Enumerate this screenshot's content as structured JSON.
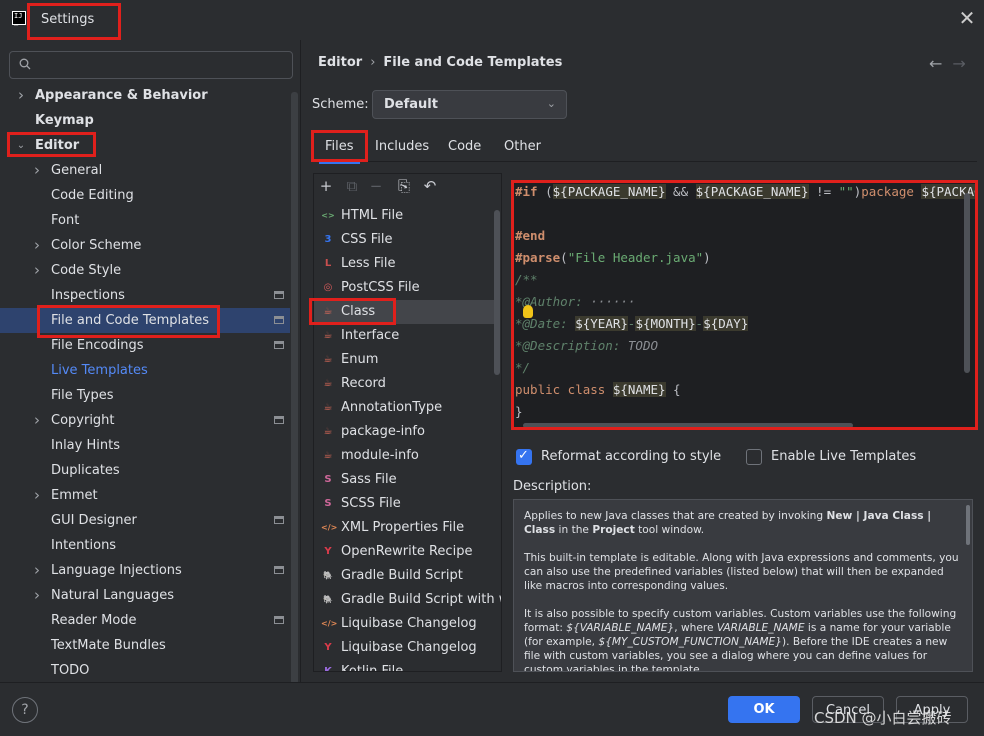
{
  "window": {
    "title": "Settings",
    "close_label": "✕"
  },
  "sidebar": {
    "search_placeholder": "",
    "items": [
      {
        "label": "Appearance & Behavior",
        "level": 0,
        "expand": "collapsed",
        "bold": true
      },
      {
        "label": "Keymap",
        "level": 0,
        "expand": "none",
        "bold": true
      },
      {
        "label": "Editor",
        "level": 0,
        "expand": "expanded",
        "bold": true
      },
      {
        "label": "General",
        "level": 1,
        "expand": "collapsed"
      },
      {
        "label": "Code Editing",
        "level": 1,
        "expand": "none"
      },
      {
        "label": "Font",
        "level": 1,
        "expand": "none"
      },
      {
        "label": "Color Scheme",
        "level": 1,
        "expand": "collapsed"
      },
      {
        "label": "Code Style",
        "level": 1,
        "expand": "collapsed"
      },
      {
        "label": "Inspections",
        "level": 1,
        "expand": "none",
        "project": true
      },
      {
        "label": "File and Code Templates",
        "level": 1,
        "expand": "none",
        "project": true,
        "selected": true
      },
      {
        "label": "File Encodings",
        "level": 1,
        "expand": "none",
        "project": true
      },
      {
        "label": "Live Templates",
        "level": 1,
        "expand": "none",
        "link": true
      },
      {
        "label": "File Types",
        "level": 1,
        "expand": "none"
      },
      {
        "label": "Copyright",
        "level": 1,
        "expand": "collapsed",
        "project": true
      },
      {
        "label": "Inlay Hints",
        "level": 1,
        "expand": "none"
      },
      {
        "label": "Duplicates",
        "level": 1,
        "expand": "none"
      },
      {
        "label": "Emmet",
        "level": 1,
        "expand": "collapsed"
      },
      {
        "label": "GUI Designer",
        "level": 1,
        "expand": "none",
        "project": true
      },
      {
        "label": "Intentions",
        "level": 1,
        "expand": "none"
      },
      {
        "label": "Language Injections",
        "level": 1,
        "expand": "collapsed",
        "project": true
      },
      {
        "label": "Natural Languages",
        "level": 1,
        "expand": "collapsed"
      },
      {
        "label": "Reader Mode",
        "level": 1,
        "expand": "none",
        "project": true
      },
      {
        "label": "TextMate Bundles",
        "level": 1,
        "expand": "none"
      },
      {
        "label": "TODO",
        "level": 1,
        "expand": "none"
      }
    ]
  },
  "breadcrumb": {
    "parent": "Editor",
    "separator": "›",
    "current": "File and Code Templates"
  },
  "nav": {
    "back": "←",
    "forward": "→"
  },
  "scheme": {
    "label": "Scheme:",
    "value": "Default",
    "arrow": "⌄"
  },
  "tabs": [
    {
      "label": "Files",
      "active": true
    },
    {
      "label": "Includes",
      "active": false
    },
    {
      "label": "Code",
      "active": false
    },
    {
      "label": "Other",
      "active": false
    }
  ],
  "toolbar": {
    "add": "+",
    "copy": "⧉",
    "remove": "−",
    "duplicate": "⎘",
    "reset": "↶"
  },
  "templates": [
    {
      "label": "HTML File",
      "icon": "html-file-icon",
      "glyph": "<>",
      "color": "#6aab73"
    },
    {
      "label": "CSS File",
      "icon": "css-file-icon",
      "glyph": "3",
      "color": "#3574f0"
    },
    {
      "label": "Less File",
      "icon": "less-file-icon",
      "glyph": "L",
      "color": "#c94f4f"
    },
    {
      "label": "PostCSS File",
      "icon": "postcss-file-icon",
      "glyph": "◎",
      "color": "#db5c5c"
    },
    {
      "label": "Class",
      "icon": "class-template-icon",
      "glyph": "☕",
      "color": "#e06c5a",
      "selected": true
    },
    {
      "label": "Interface",
      "icon": "interface-template-icon",
      "glyph": "☕",
      "color": "#e06c5a"
    },
    {
      "label": "Enum",
      "icon": "enum-template-icon",
      "glyph": "☕",
      "color": "#e06c5a"
    },
    {
      "label": "Record",
      "icon": "record-template-icon",
      "glyph": "☕",
      "color": "#e06c5a"
    },
    {
      "label": "AnnotationType",
      "icon": "annotation-template-icon",
      "glyph": "☕",
      "color": "#e06c5a"
    },
    {
      "label": "package-info",
      "icon": "package-info-icon",
      "glyph": "☕",
      "color": "#e06c5a"
    },
    {
      "label": "module-info",
      "icon": "module-info-icon",
      "glyph": "☕",
      "color": "#e06c5a"
    },
    {
      "label": "Sass File",
      "icon": "sass-file-icon",
      "glyph": "S",
      "color": "#cd6799"
    },
    {
      "label": "SCSS File",
      "icon": "scss-file-icon",
      "glyph": "S",
      "color": "#cd6799"
    },
    {
      "label": "XML Properties File",
      "icon": "xml-file-icon",
      "glyph": "</>",
      "color": "#e08855"
    },
    {
      "label": "OpenRewrite Recipe",
      "icon": "openrewrite-icon",
      "glyph": "Y",
      "color": "#db3b4b"
    },
    {
      "label": "Gradle Build Script",
      "icon": "gradle-icon",
      "glyph": "🐘",
      "color": "#a0a3a8"
    },
    {
      "label": "Gradle Build Script with wra",
      "icon": "gradle-wrapper-icon",
      "glyph": "🐘",
      "color": "#a0a3a8"
    },
    {
      "label": "Liquibase Changelog",
      "icon": "liquibase-xml-icon",
      "glyph": "</>",
      "color": "#e08855"
    },
    {
      "label": "Liquibase Changelog",
      "icon": "liquibase-yaml-icon",
      "glyph": "Y",
      "color": "#db3b4b"
    },
    {
      "label": "Kotlin File",
      "icon": "kotlin-file-icon",
      "glyph": "K",
      "color": "#9b6bdf"
    }
  ],
  "editor": {
    "lines": [
      [
        {
          "t": "#if",
          "c": "kw"
        },
        {
          "t": " (",
          "c": "pl"
        },
        {
          "t": "${PACKAGE_NAME}",
          "c": "var"
        },
        {
          "t": " && ",
          "c": "pl"
        },
        {
          "t": "${PACKAGE_NAME}",
          "c": "var"
        },
        {
          "t": " != ",
          "c": "pl"
        },
        {
          "t": "\"\"",
          "c": "str"
        },
        {
          "t": ")",
          "c": "pl"
        },
        {
          "t": "package ",
          "c": "kwn"
        },
        {
          "t": "${PACKAGE_NAME}",
          "c": "var"
        }
      ],
      [],
      [
        {
          "t": "#end",
          "c": "kw"
        }
      ],
      [
        {
          "t": "#parse",
          "c": "kw"
        },
        {
          "t": "(",
          "c": "pl"
        },
        {
          "t": "\"File Header.java\"",
          "c": "str"
        },
        {
          "t": ")",
          "c": "pl"
        }
      ],
      [
        {
          "t": "/**",
          "c": "cm"
        }
      ],
      [
        {
          "t": "*@Author:",
          "c": "cm"
        },
        {
          "t": " ",
          "c": "cmt"
        },
        {
          "t": "······",
          "c": "cmt"
        }
      ],
      [
        {
          "t": "*@Date: ",
          "c": "cm"
        },
        {
          "t": "${YEAR}",
          "c": "var"
        },
        {
          "t": "-",
          "c": "cm"
        },
        {
          "t": "${MONTH}",
          "c": "var"
        },
        {
          "t": "-",
          "c": "cm"
        },
        {
          "t": "${DAY}",
          "c": "var"
        }
      ],
      [
        {
          "t": "*@Description: ",
          "c": "cm"
        },
        {
          "t": "TODO",
          "c": "cmt"
        }
      ],
      [
        {
          "t": "*/",
          "c": "cm"
        }
      ],
      [
        {
          "t": "public class ",
          "c": "kwn"
        },
        {
          "t": "${NAME}",
          "c": "var"
        },
        {
          "t": " {",
          "c": "pl"
        }
      ],
      [
        {
          "t": "}",
          "c": "pl"
        }
      ]
    ]
  },
  "options": {
    "reformat": {
      "label": "Reformat according to style",
      "checked": true
    },
    "live_templates": {
      "label": "Enable Live Templates",
      "checked": false
    }
  },
  "description": {
    "label": "Description:",
    "p1": [
      {
        "t": "Applies to new Java classes that are created by invoking "
      },
      {
        "t": "New | Java Class | Class",
        "b": true
      },
      {
        "t": " in the "
      },
      {
        "t": "Project",
        "b": true
      },
      {
        "t": " tool window."
      }
    ],
    "p2": "This built-in template is editable. Along with Java expressions and comments, you can also use the predefined variables (listed below) that will then be expanded like macros into corresponding values.",
    "p3": [
      {
        "t": "It is also possible to specify custom variables. Custom variables use the following format: "
      },
      {
        "t": "${VARIABLE_NAME}",
        "i": true
      },
      {
        "t": ", where "
      },
      {
        "t": "VARIABLE_NAME",
        "i": true
      },
      {
        "t": " is a name for your variable (for example, "
      },
      {
        "t": "${MY_CUSTOM_FUNCTION_NAME}",
        "i": true
      },
      {
        "t": "). Before the IDE creates a new file with custom variables, you see a dialog where you can define values for custom variables in the template."
      }
    ]
  },
  "footer": {
    "help": "?",
    "ok": "OK",
    "cancel": "Cancel",
    "apply": "Apply",
    "watermark": "CSDN @小白尝搬砖"
  }
}
